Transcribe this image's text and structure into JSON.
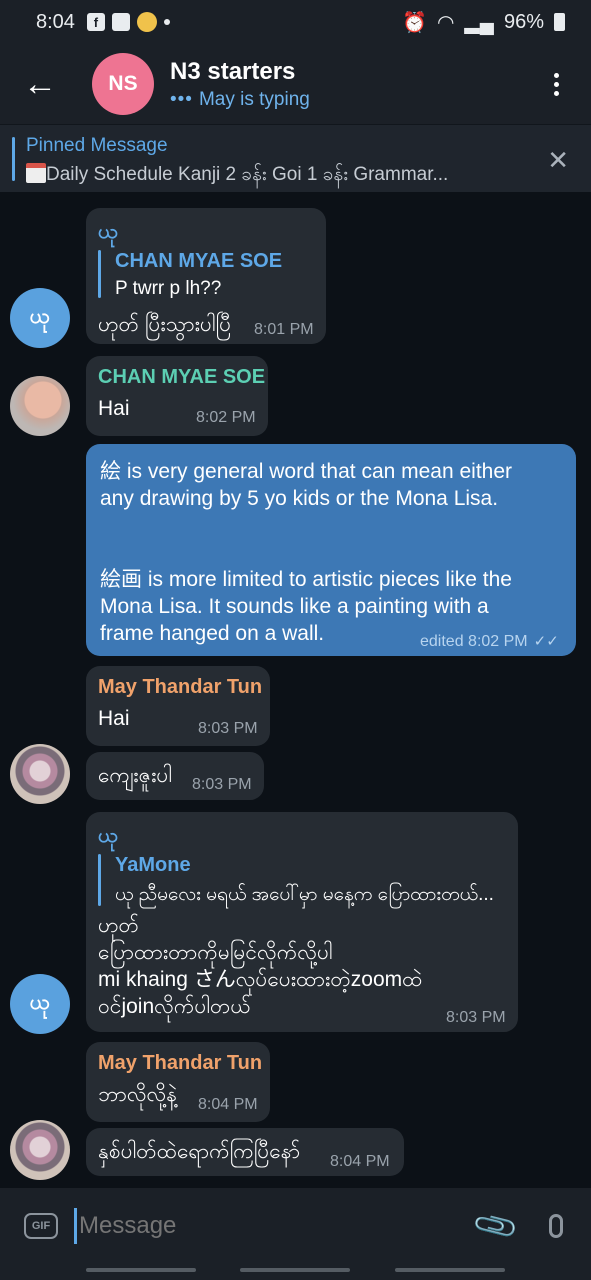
{
  "status": {
    "time": "8:04",
    "battery": "96%"
  },
  "header": {
    "avatar_initials": "NS",
    "title": "N3 starters",
    "typing_dots": "•••",
    "subtitle": "May is typing"
  },
  "pinned": {
    "title": "Pinned Message",
    "text": "Daily Schedule   Kanji 2 ခန်း  Goi 1 ခန်း  Grammar..."
  },
  "colors": {
    "accent": "#5ea8e7",
    "outgoing": "#3d78b5",
    "incoming": "#262c33",
    "chan": "#5ccfb3",
    "may": "#f0a26b"
  },
  "messages": [
    {
      "sender": "ယု",
      "reply_name": "CHAN MYAE SOE",
      "reply_text": "P twrr p lh??",
      "text": "ဟုတ် ပြီးသွားပါပြီ",
      "time": "8:01 PM"
    },
    {
      "sender": "CHAN MYAE SOE",
      "text": "Hai",
      "time": "8:02 PM"
    },
    {
      "line1": "絵 is very general word that can mean either",
      "line2": "any drawing by 5 yo kids or the Mona Lisa.",
      "line3": "絵画 is more limited to artistic pieces like the",
      "line4": "Mona Lisa. It sounds like a painting with a",
      "line5": "frame hanged on a wall.",
      "time": "edited 8:02 PM"
    },
    {
      "sender": "May Thandar Tun",
      "text": "Hai",
      "time": "8:03 PM"
    },
    {
      "text": "ကျေးဇူးပါ",
      "time": "8:03 PM"
    },
    {
      "sender": "ယု",
      "reply_name": "YaMone",
      "reply_text": "ယု ညီမလေး မရယ် အပေါ်မှာ မနေ့က ပြောထားတယ်...",
      "line1": "ဟုတ်",
      "line2": "ပြောထားတာကိုမမြင်လိုက်လို့ပါ",
      "line3": "mi khaing さんလုပ်ပေးထားတဲ့zoomထဲ",
      "line4": "ဝင်joinလိုက်ပါတယ်",
      "time": "8:03 PM"
    },
    {
      "sender": "May Thandar Tun",
      "text": "ဘာလိုလို့နဲ့",
      "time": "8:04 PM"
    },
    {
      "text": "နှစ်ပါတ်ထဲရောက်ကြပြီနော်",
      "time": "8:04 PM"
    }
  ],
  "avatars": {
    "yu": "ယု"
  },
  "input": {
    "gif_label": "GIF",
    "placeholder": "Message"
  }
}
